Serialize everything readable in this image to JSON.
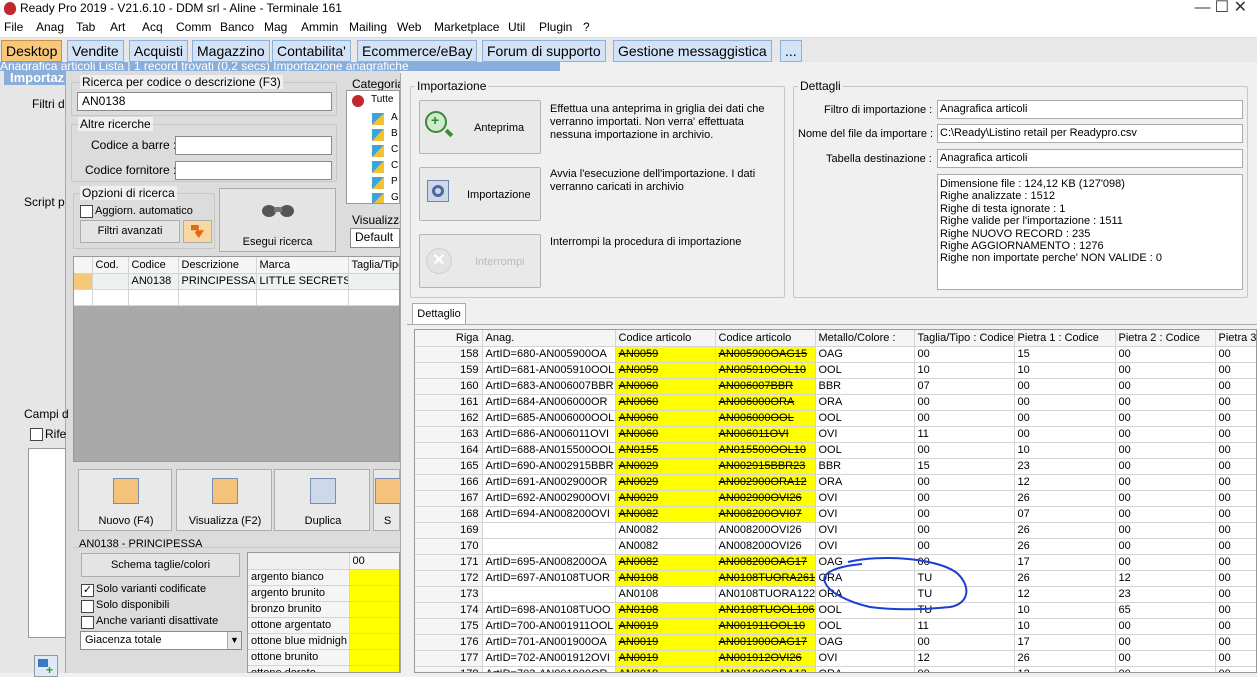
{
  "window": {
    "title": "Ready Pro 2019 - V21.6.10 - DDM srl - Aline - Terminale 161",
    "controls": "— ☐ ✕"
  },
  "menu": [
    "File",
    "Anag",
    "Tab",
    "Art",
    "Acq",
    "Comm",
    "Banco",
    "Mag",
    "Ammin",
    "Mailing",
    "Web",
    "Marketplace",
    "Util",
    "Plugin",
    "?"
  ],
  "tabs": [
    "Desktop",
    "Vendite",
    "Acquisti",
    "Magazzino",
    "Contabilita'",
    "Ecommerce/eBay",
    "Forum di supporto",
    "Gestione messaggistica",
    "..."
  ],
  "back_window": {
    "header_text": "Anagrafica articoli    Lista | 1 record trovati (0,2 secs) Importazione anagrafiche",
    "side_title": "Importaz",
    "side_labels": [
      "Filtri d",
      "Script p",
      "Campi d",
      "Rife"
    ],
    "search": {
      "group_label": "Ricerca per codice o descrizione (F3)",
      "value": "AN0138"
    },
    "other_searches": {
      "group_label": "Altre ricerche",
      "barcode_label": "Codice a barre :",
      "supplier_label": "Codice fornitore :"
    },
    "options": {
      "group_label": "Opzioni di ricerca",
      "auto_update": "Aggiorn. automatico",
      "advanced_filters": "Filtri avanzati",
      "run_search": "Esegui ricerca"
    },
    "categories": {
      "label": "Categoria",
      "root": "Tutte",
      "items": [
        "A",
        "B",
        "C",
        "C",
        "P",
        "G"
      ]
    },
    "view": {
      "label": "Visualizza",
      "value": "Default"
    },
    "results": {
      "columns": [
        "Cod.",
        "Codice",
        "Descrizione",
        "Marca",
        "Taglia/Tipo"
      ],
      "rows": [
        {
          "cod": "",
          "codice": "AN0138",
          "descrizione": "PRINCIPESSA",
          "marca": "LITTLE SECRETS",
          "taglia": ""
        }
      ]
    },
    "actions": [
      "Nuovo (F4)",
      "Visualizza (F2)",
      "Duplica",
      "S"
    ],
    "variants": {
      "title": "AN0138 - PRINCIPESSA",
      "scheme_button": "Schema taglie/colori",
      "options": [
        {
          "label": "Solo varianti codificate",
          "checked": true
        },
        {
          "label": "Solo disponibili",
          "checked": false
        },
        {
          "label": "Anche varianti disattivate",
          "checked": false
        }
      ],
      "stock_select": "Giacenza totale",
      "grid_header": "00",
      "colors": [
        "argento bianco",
        "argento brunito",
        "bronzo brunito",
        "ottone argentato",
        "ottone blue midnigh",
        "ottone brunito",
        "ottone dorato"
      ]
    }
  },
  "import_window": {
    "import_group": "Importazione",
    "preview": {
      "label": "Anteprima",
      "description": "Effettua una anteprima in griglia dei dati che verranno importati. Non verra' effettuata nessuna importazione in archivio."
    },
    "run": {
      "label": "Importazione",
      "description": "Avvia l'esecuzione dell'importazione. I dati verranno caricati in archivio"
    },
    "stop": {
      "label": "Interrompi",
      "description": "Interrompi la procedura di importazione"
    },
    "details": {
      "group": "Dettagli",
      "filter_label": "Filtro di importazione :",
      "filter_value": "Anagrafica articoli",
      "file_label": "Nome del file da importare :",
      "file_value": "C:\\Ready\\Listino retail per Readypro.csv",
      "dest_label": "Tabella destinazione :",
      "dest_value": "Anagrafica articoli",
      "summary": [
        "Dimensione file : 124,12 KB (127'098)",
        "Righe analizzate : 1512",
        "Righe di testa ignorate : 1",
        "Righe valide per l'importazione : 1511",
        "Righe NUOVO RECORD : 235",
        "Righe AGGIORNAMENTO  : 1276",
        "Righe non importate perche' NON VALIDE : 0"
      ]
    },
    "detail_tab": "Dettaglio",
    "grid": {
      "columns": [
        "Riga",
        "Anag.",
        "Codice articolo",
        "Codice articolo",
        "Metallo/Colore :",
        "Taglia/Tipo : Codice",
        "Pietra 1 : Codice",
        "Pietra 2 : Codice",
        "Pietra 3"
      ],
      "rows": [
        {
          "riga": "158",
          "anag": "ArtID=680-AN005900OA",
          "c1": "AN0059",
          "c2": "AN005900OAG15",
          "met": "OAG",
          "tag": "00",
          "p1": "15",
          "p2": "00",
          "p3": "00",
          "hl": true
        },
        {
          "riga": "159",
          "anag": "ArtID=681-AN005910OOL",
          "c1": "AN0059",
          "c2": "AN005910OOL10",
          "met": "OOL",
          "tag": "10",
          "p1": "10",
          "p2": "00",
          "p3": "00",
          "hl": true
        },
        {
          "riga": "160",
          "anag": "ArtID=683-AN006007BBR",
          "c1": "AN0060",
          "c2": "AN006007BBR",
          "met": "BBR",
          "tag": "07",
          "p1": "00",
          "p2": "00",
          "p3": "00",
          "hl": true
        },
        {
          "riga": "161",
          "anag": "ArtID=684-AN006000OR",
          "c1": "AN0060",
          "c2": "AN006000ORA",
          "met": "ORA",
          "tag": "00",
          "p1": "00",
          "p2": "00",
          "p3": "00",
          "hl": true
        },
        {
          "riga": "162",
          "anag": "ArtID=685-AN006000OOL",
          "c1": "AN0060",
          "c2": "AN006000OOL",
          "met": "OOL",
          "tag": "00",
          "p1": "00",
          "p2": "00",
          "p3": "00",
          "hl": true
        },
        {
          "riga": "163",
          "anag": "ArtID=686-AN006011OVI",
          "c1": "AN0060",
          "c2": "AN006011OVI",
          "met": "OVI",
          "tag": "11",
          "p1": "00",
          "p2": "00",
          "p3": "00",
          "hl": true
        },
        {
          "riga": "164",
          "anag": "ArtID=688-AN015500OOL",
          "c1": "AN0155",
          "c2": "AN015500OOL10",
          "met": "OOL",
          "tag": "00",
          "p1": "10",
          "p2": "00",
          "p3": "00",
          "hl": true
        },
        {
          "riga": "165",
          "anag": "ArtID=690-AN002915BBR",
          "c1": "AN0029",
          "c2": "AN002915BBR23",
          "met": "BBR",
          "tag": "15",
          "p1": "23",
          "p2": "00",
          "p3": "00",
          "hl": true
        },
        {
          "riga": "166",
          "anag": "ArtID=691-AN002900OR",
          "c1": "AN0029",
          "c2": "AN002900ORA12",
          "met": "ORA",
          "tag": "00",
          "p1": "12",
          "p2": "00",
          "p3": "00",
          "hl": true
        },
        {
          "riga": "167",
          "anag": "ArtID=692-AN002900OVI",
          "c1": "AN0029",
          "c2": "AN002900OVI26",
          "met": "OVI",
          "tag": "00",
          "p1": "26",
          "p2": "00",
          "p3": "00",
          "hl": true
        },
        {
          "riga": "168",
          "anag": "ArtID=694-AN008200OVI",
          "c1": "AN0082",
          "c2": "AN008200OVI07",
          "met": "OVI",
          "tag": "00",
          "p1": "07",
          "p2": "00",
          "p3": "00",
          "hl": true
        },
        {
          "riga": "169",
          "anag": "",
          "c1": "AN0082",
          "c2": "AN008200OVI26",
          "met": "OVI",
          "tag": "00",
          "p1": "26",
          "p2": "00",
          "p3": "00",
          "hl": false
        },
        {
          "riga": "170",
          "anag": "",
          "c1": "AN0082",
          "c2": "AN008200OVI26",
          "met": "OVI",
          "tag": "00",
          "p1": "26",
          "p2": "00",
          "p3": "00",
          "hl": false
        },
        {
          "riga": "171",
          "anag": "ArtID=695-AN008200OA",
          "c1": "AN0082",
          "c2": "AN008200OAG17",
          "met": "OAG",
          "tag": "00",
          "p1": "17",
          "p2": "00",
          "p3": "00",
          "hl": true
        },
        {
          "riga": "172",
          "anag": "ArtID=697-AN0108TUOR",
          "c1": "AN0108",
          "c2": "AN0108TUORA261",
          "met": "ORA",
          "tag": "TU",
          "p1": "26",
          "p2": "12",
          "p3": "00",
          "hl": true
        },
        {
          "riga": "173",
          "anag": "",
          "c1": "AN0108",
          "c2": "AN0108TUORA122",
          "met": "ORA",
          "tag": "TU",
          "p1": "12",
          "p2": "23",
          "p3": "00",
          "hl": false
        },
        {
          "riga": "174",
          "anag": "ArtID=698-AN0108TUOO",
          "c1": "AN0108",
          "c2": "AN0108TUOOL106",
          "met": "OOL",
          "tag": "TU",
          "p1": "10",
          "p2": "65",
          "p3": "00",
          "hl": true
        },
        {
          "riga": "175",
          "anag": "ArtID=700-AN001911OOL",
          "c1": "AN0019",
          "c2": "AN001911OOL10",
          "met": "OOL",
          "tag": "11",
          "p1": "10",
          "p2": "00",
          "p3": "00",
          "hl": true
        },
        {
          "riga": "176",
          "anag": "ArtID=701-AN001900OA",
          "c1": "AN0019",
          "c2": "AN001900OAG17",
          "met": "OAG",
          "tag": "00",
          "p1": "17",
          "p2": "00",
          "p3": "00",
          "hl": true
        },
        {
          "riga": "177",
          "anag": "ArtID=702-AN001912OVI",
          "c1": "AN0019",
          "c2": "AN001912OVI26",
          "met": "OVI",
          "tag": "12",
          "p1": "26",
          "p2": "00",
          "p3": "00",
          "hl": true
        },
        {
          "riga": "178",
          "anag": "ArtID=703-AN001900OR",
          "c1": "AN0019",
          "c2": "AN001900ORA12",
          "met": "ORA",
          "tag": "00",
          "p1": "12",
          "p2": "00",
          "p3": "00",
          "hl": true
        }
      ]
    }
  },
  "colors": {
    "highlight": "#ffff00",
    "active_tab": "#f7c87a",
    "tab": "#d2e3f7",
    "annotation": "#1a3fd1"
  }
}
